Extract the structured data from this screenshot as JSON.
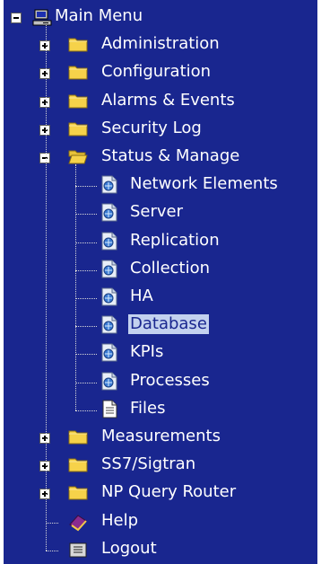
{
  "tree": {
    "root": {
      "label": "Main Menu",
      "icon": "computer-icon",
      "expanded": true
    },
    "items": [
      {
        "label": "Administration",
        "icon": "folder-icon",
        "expanded": false
      },
      {
        "label": "Configuration",
        "icon": "folder-icon",
        "expanded": false
      },
      {
        "label": "Alarms & Events",
        "icon": "folder-icon",
        "expanded": false
      },
      {
        "label": "Security Log",
        "icon": "folder-icon",
        "expanded": false
      },
      {
        "label": "Status & Manage",
        "icon": "folder-open-icon",
        "expanded": true,
        "children": [
          {
            "label": "Network Elements",
            "icon": "status-page-icon"
          },
          {
            "label": "Server",
            "icon": "status-page-icon"
          },
          {
            "label": "Replication",
            "icon": "status-page-icon"
          },
          {
            "label": "Collection",
            "icon": "status-page-icon"
          },
          {
            "label": "HA",
            "icon": "status-page-icon"
          },
          {
            "label": "Database",
            "icon": "status-page-icon",
            "selected": true
          },
          {
            "label": "KPIs",
            "icon": "status-page-icon"
          },
          {
            "label": "Processes",
            "icon": "status-page-icon"
          },
          {
            "label": "Files",
            "icon": "document-icon"
          }
        ]
      },
      {
        "label": "Measurements",
        "icon": "folder-icon",
        "expanded": false
      },
      {
        "label": "SS7/Sigtran",
        "icon": "folder-icon",
        "expanded": false
      },
      {
        "label": "NP Query Router",
        "icon": "folder-icon",
        "expanded": false
      },
      {
        "label": "Help",
        "icon": "help-book-icon"
      },
      {
        "label": "Logout",
        "icon": "logout-icon"
      }
    ]
  },
  "colors": {
    "background": "#19268f",
    "text": "#ffffff",
    "selected_background": "#c3d1ef",
    "selected_text": "#19268f",
    "folder": "#f6d24a"
  }
}
